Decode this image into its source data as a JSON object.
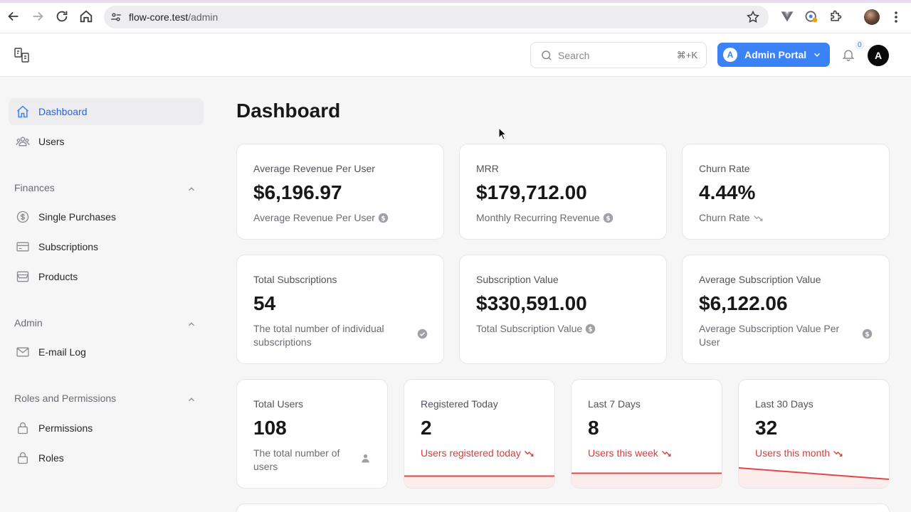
{
  "browser": {
    "url_host": "flow-core.test",
    "url_path": "/admin"
  },
  "header": {
    "search_placeholder": "Search",
    "search_shortcut": "⌘+K",
    "portal_badge": "A",
    "portal_label": "Admin Portal",
    "notification_count": "0",
    "avatar_initial": "A"
  },
  "sidebar": {
    "items": [
      {
        "label": "Dashboard",
        "icon": "home-icon",
        "active": true
      },
      {
        "label": "Users",
        "icon": "users-icon"
      }
    ],
    "groups": [
      {
        "label": "Finances",
        "items": [
          {
            "label": "Single Purchases",
            "icon": "dollar-circle-icon"
          },
          {
            "label": "Subscriptions",
            "icon": "credit-card-icon"
          },
          {
            "label": "Products",
            "icon": "archive-box-icon"
          }
        ]
      },
      {
        "label": "Admin",
        "items": [
          {
            "label": "E-mail Log",
            "icon": "envelope-icon"
          }
        ]
      },
      {
        "label": "Roles and Permissions",
        "items": [
          {
            "label": "Permissions",
            "icon": "lock-icon"
          },
          {
            "label": "Roles",
            "icon": "lock-icon"
          }
        ]
      }
    ]
  },
  "main": {
    "title": "Dashboard",
    "cards": [
      {
        "label": "Average Revenue Per User",
        "value": "$6,196.97",
        "description": "Average Revenue Per User",
        "icon": "dollar-circle-icon"
      },
      {
        "label": "MRR",
        "value": "$179,712.00",
        "description": "Monthly Recurring Revenue",
        "icon": "dollar-circle-icon"
      },
      {
        "label": "Churn Rate",
        "value": "4.44%",
        "description": "Churn Rate",
        "icon": "trending-down-icon"
      },
      {
        "label": "Total Subscriptions",
        "value": "54",
        "description": "The total number of individual subscriptions",
        "icon": "check-circle-icon"
      },
      {
        "label": "Subscription Value",
        "value": "$330,591.00",
        "description": "Total Subscription Value",
        "icon": "dollar-circle-icon"
      },
      {
        "label": "Average Subscription Value",
        "value": "$6,122.06",
        "description": "Average Subscription Value Per User",
        "icon": "dollar-circle-icon"
      },
      {
        "label": "Total Users",
        "value": "108",
        "description": "The total number of users",
        "icon": "user-icon"
      },
      {
        "label": "Registered Today",
        "value": "2",
        "description": "Users registered today",
        "icon": "trending-down-icon"
      },
      {
        "label": "Last 7 Days",
        "value": "8",
        "description": "Users this week",
        "icon": "trending-down-icon"
      },
      {
        "label": "Last 30 Days",
        "value": "32",
        "description": "Users this month",
        "icon": "trending-down-icon"
      }
    ]
  },
  "colors": {
    "accent": "#3b82f6",
    "danger": "#dc3a3a"
  }
}
